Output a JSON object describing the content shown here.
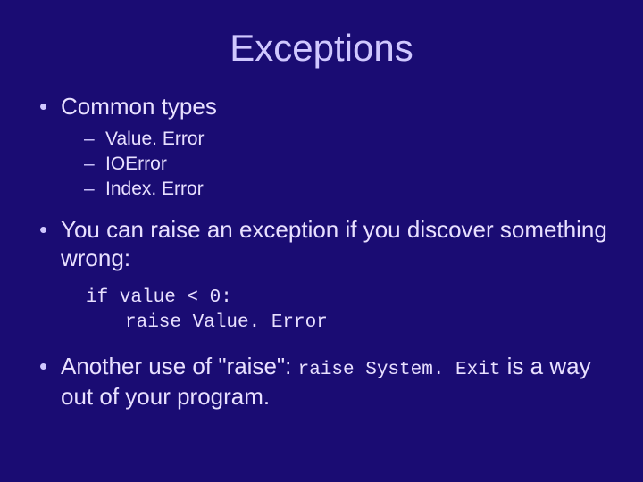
{
  "title": "Exceptions",
  "bullets": {
    "b1": {
      "text": "Common types",
      "sub": [
        "Value. Error",
        "IOError",
        "Index. Error"
      ]
    },
    "b2": {
      "text": "You can raise an exception if you discover something wrong:",
      "code": {
        "line1": "if value < 0:",
        "line2": "raise Value. Error"
      }
    },
    "b3": {
      "pre": "Another use of \"raise\":  ",
      "code": "raise System. Exit",
      "post": "  is a way out of your program."
    }
  }
}
